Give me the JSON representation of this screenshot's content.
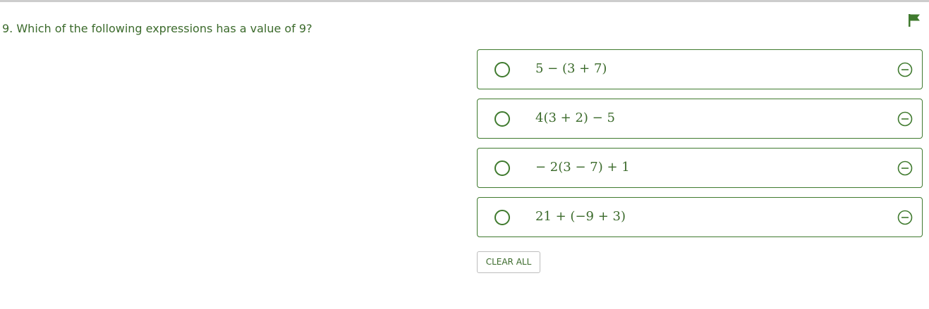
{
  "question": {
    "number": "9.",
    "text": "9. Which of the following expressions has a value of 9?"
  },
  "choices": [
    {
      "expression": "5 − (3 + 7)",
      "selected": false
    },
    {
      "expression": "4(3 + 2) − 5",
      "selected": false
    },
    {
      "expression": "− 2(3 − 7) + 1",
      "selected": false
    },
    {
      "expression": "21 + (−9 + 3)",
      "selected": false
    }
  ],
  "actions": {
    "clear_all_label": "CLEAR ALL"
  },
  "icons": {
    "flag": "flag-icon",
    "radio": "radio-icon",
    "eliminate": "eliminate-choice-icon"
  },
  "colors": {
    "accent": "#3f7a2e",
    "text": "#3b6a2b",
    "divider": "#cdcdcd",
    "button_border": "#bdbdbd"
  }
}
